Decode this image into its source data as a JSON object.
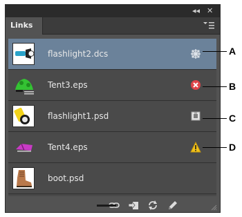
{
  "panel": {
    "title_controls": {
      "collapse_glyph": "◂◂",
      "close_glyph": "✕"
    },
    "tab_label": "Links",
    "menu_icon": "panel-menu-icon"
  },
  "links": [
    {
      "filename": "flashlight2.dcs",
      "status": "embedded",
      "status_icon": "embedded-icon",
      "selected": true,
      "callout": "A"
    },
    {
      "filename": "Tent3.eps",
      "status": "missing",
      "status_icon": "missing-link-icon",
      "selected": false,
      "callout": "B"
    },
    {
      "filename": "flashlight1.psd",
      "status": "edited-in-place",
      "status_icon": "edited-link-icon",
      "selected": false,
      "callout": "C"
    },
    {
      "filename": "Tent4.eps",
      "status": "modified",
      "status_icon": "warning-icon",
      "selected": false,
      "callout": "D"
    },
    {
      "filename": "boot.psd",
      "status": "ok",
      "status_icon": "",
      "selected": false,
      "callout": ""
    }
  ],
  "toolbar": [
    {
      "name": "relink-icon"
    },
    {
      "name": "go-to-link-icon"
    },
    {
      "name": "update-link-icon"
    },
    {
      "name": "edit-original-icon"
    }
  ],
  "colors": {
    "panel_bg": "#535353",
    "selected_row": "#6b829a",
    "missing": "#e0444a",
    "warning": "#f2c21a"
  }
}
